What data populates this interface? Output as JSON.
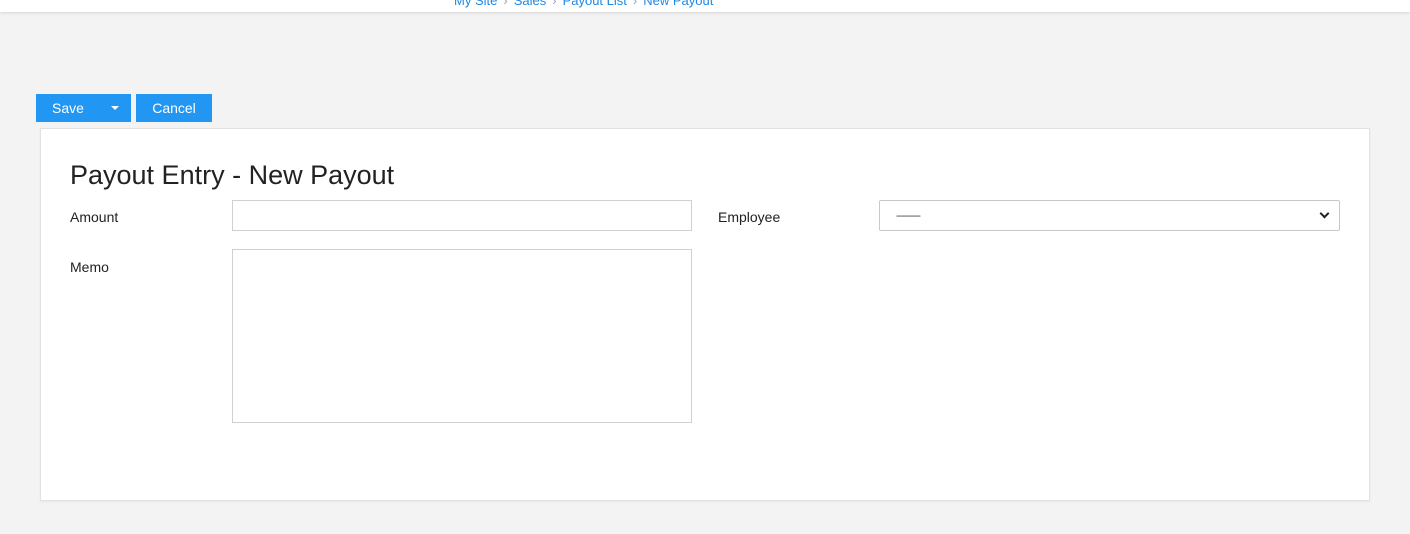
{
  "breadcrumb": {
    "items": [
      "My Site",
      "Sales",
      "Payout List",
      "New Payout"
    ],
    "separator": "›"
  },
  "toolbar": {
    "save_label": "Save",
    "cancel_label": "Cancel"
  },
  "form": {
    "title": "Payout Entry - New Payout",
    "amount": {
      "label": "Amount",
      "value": ""
    },
    "memo": {
      "label": "Memo",
      "value": ""
    },
    "employee": {
      "label": "Employee",
      "selected": "---------"
    }
  },
  "colors": {
    "accent": "#2196f3",
    "link": "#1e88e5",
    "page_background": "#f3f3f3",
    "card_background": "#ffffff"
  }
}
